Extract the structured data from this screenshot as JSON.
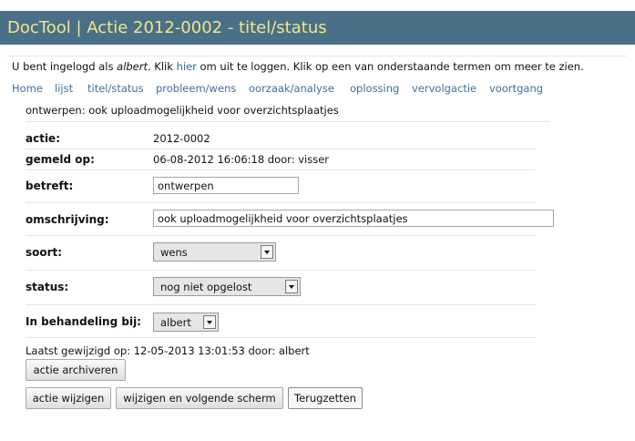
{
  "window": {
    "title": "DocTool | Actie 2012-0002 - titel/status"
  },
  "login": {
    "prefix": "U bent ingelogd als ",
    "user": "albert",
    "mid": ". Klik ",
    "link": "hier",
    "suffix": " om uit te loggen. Klik op een van onderstaande termen om meer te zien."
  },
  "nav": [
    "Home",
    "lijst",
    "titel/status",
    "probleem/wens",
    "oorzaak/analyse",
    "oplossing",
    "vervolgactie",
    "voortgang"
  ],
  "summary": "ontwerpen: ook uploadmogelijkheid voor overzichtsplaatjes",
  "form": {
    "actie": {
      "label": "actie:",
      "value": "2012-0002"
    },
    "gemeld": {
      "label": "gemeld op:",
      "value": "06-08-2012 16:06:18 door: visser"
    },
    "betreft": {
      "label": "betreft:",
      "value": "ontwerpen"
    },
    "omschrijving": {
      "label": "omschrijving:",
      "value": "ook uploadmogelijkheid voor overzichtsplaatjes"
    },
    "soort": {
      "label": "soort:",
      "value": "wens"
    },
    "status": {
      "label": "status:",
      "value": "nog niet opgelost"
    },
    "behandeling": {
      "label": "In behandeling bij:",
      "value": "albert"
    }
  },
  "laatst": "Laatst gewijzigd op: 12-05-2013 13:01:53 door: albert",
  "buttons": {
    "archiveren": "actie archiveren",
    "wijzigen": "actie wijzigen",
    "wijzigen_volgende": "wijzigen en volgende scherm",
    "terugzetten": "Terugzetten"
  }
}
